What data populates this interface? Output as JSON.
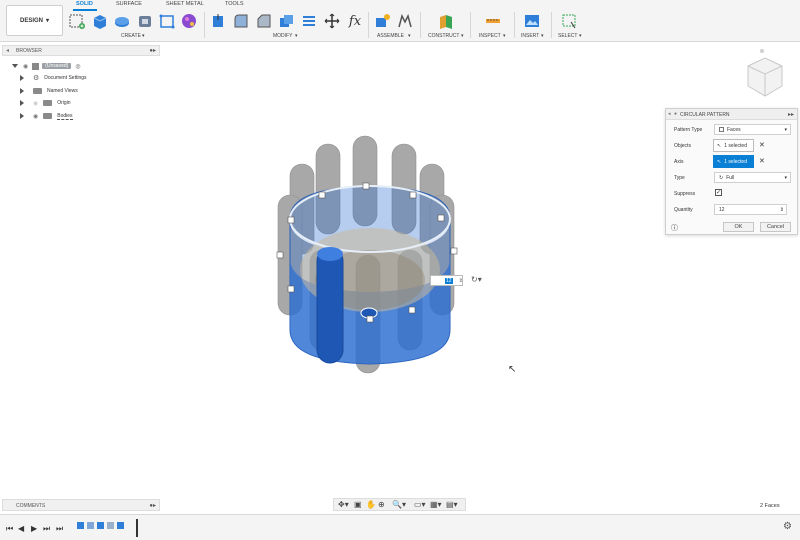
{
  "design_button": "DESIGN",
  "tabs": [
    "SOLID",
    "SURFACE",
    "SHEET METAL",
    "TOOLS"
  ],
  "groups": [
    "CREATE",
    "MODIFY",
    "ASSEMBLE",
    "CONSTRUCT",
    "INSPECT",
    "INSERT",
    "SELECT"
  ],
  "browser": {
    "title": "BROWSER",
    "root": "(Unsaved)",
    "items": [
      "Document Settings",
      "Named Views",
      "Origin",
      "Bodies"
    ]
  },
  "dialog": {
    "title": "CIRCULAR PATTERN",
    "pattern_type_label": "Pattern Type",
    "pattern_type_value": "Faces",
    "objects_label": "Objects",
    "objects_value": "1 selected",
    "axis_label": "Axis",
    "axis_value": "1 selected",
    "type_label": "Type",
    "type_value": "Full",
    "suppress_label": "Suppress",
    "quantity_label": "Quantity",
    "quantity_value": "12",
    "ok": "OK",
    "cancel": "Cancel"
  },
  "viewport": {
    "quantity_value": "12"
  },
  "comments_title": "COMMENTS",
  "status": "2 Faces",
  "colors": {
    "accent": "#0a7fd6",
    "body_blue": "#2f6fd0",
    "ghost_gray": "#9a9a9a"
  }
}
